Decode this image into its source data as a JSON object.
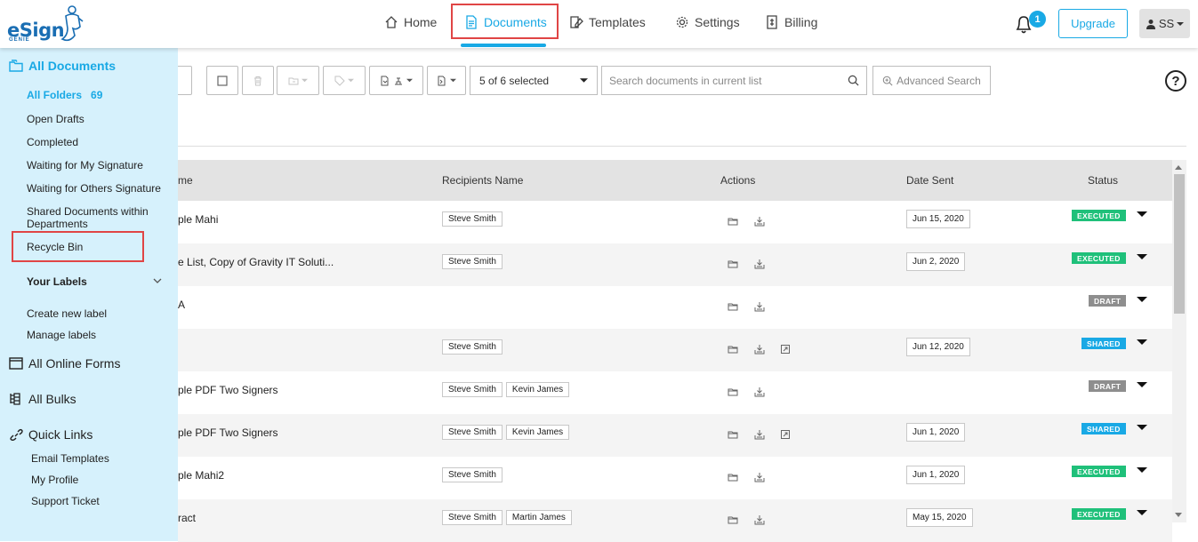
{
  "app": {
    "logo_text": "eSign",
    "logo_sub": "GENIE"
  },
  "nav": {
    "home": "Home",
    "documents": "Documents",
    "templates": "Templates",
    "settings": "Settings",
    "billing": "Billing"
  },
  "header": {
    "notification_count": "1",
    "upgrade_label": "Upgrade",
    "user_initials": "SS"
  },
  "colors": {
    "accent": "#19a9e5",
    "executed": "#1fc07a",
    "draft": "#8e8e8e",
    "shared": "#19a9e5",
    "highlight": "#e04545"
  },
  "sidebar": {
    "all_documents": "All Documents",
    "folders": [
      {
        "label": "All Folders",
        "count": "69"
      },
      {
        "label": "Open Drafts"
      },
      {
        "label": "Completed"
      },
      {
        "label": "Waiting for My Signature"
      },
      {
        "label": "Waiting for Others Signature"
      },
      {
        "label": "Shared Documents within Departments"
      },
      {
        "label": "Recycle Bin"
      }
    ],
    "your_labels": "Your Labels",
    "create_label": "Create new label",
    "manage_labels": "Manage labels",
    "all_online_forms": "All Online Forms",
    "all_bulks": "All Bulks",
    "quick_links": "Quick Links",
    "quick_items": [
      "Email Templates",
      "My Profile",
      "Support Ticket"
    ]
  },
  "toolbar": {
    "selection": "5 of 6 selected",
    "search_placeholder": "Search documents in current list",
    "advanced_search": "Advanced Search",
    "help": "?"
  },
  "table": {
    "headers": {
      "name": "me",
      "recipients": "Recipients Name",
      "actions": "Actions",
      "date": "Date Sent",
      "status": "Status"
    },
    "rows": [
      {
        "name": "ple Mahi",
        "recipients": [
          "Steve Smith"
        ],
        "date": "Jun 15, 2020",
        "status": "EXECUTED",
        "share_icon": false
      },
      {
        "name": "e List, Copy of Gravity IT Soluti...",
        "recipients": [
          "Steve Smith"
        ],
        "date": "Jun 2, 2020",
        "status": "EXECUTED",
        "share_icon": false
      },
      {
        "name": "A",
        "recipients": [],
        "date": "",
        "status": "DRAFT",
        "share_icon": false
      },
      {
        "name": "",
        "recipients": [
          "Steve Smith"
        ],
        "date": "Jun 12, 2020",
        "status": "SHARED",
        "share_icon": true
      },
      {
        "name": "ple PDF Two Signers",
        "recipients": [
          "Steve Smith",
          "Kevin James"
        ],
        "date": "",
        "status": "DRAFT",
        "share_icon": false
      },
      {
        "name": "ple PDF Two Signers",
        "recipients": [
          "Steve Smith",
          "Kevin James"
        ],
        "date": "Jun 1, 2020",
        "status": "SHARED",
        "share_icon": true
      },
      {
        "name": "ple Mahi2",
        "recipients": [
          "Steve Smith"
        ],
        "date": "Jun 1, 2020",
        "status": "EXECUTED",
        "share_icon": false
      },
      {
        "name": "ract",
        "recipients": [
          "Steve Smith",
          "Martin James"
        ],
        "date": "May 15, 2020",
        "status": "EXECUTED",
        "share_icon": false
      }
    ]
  }
}
